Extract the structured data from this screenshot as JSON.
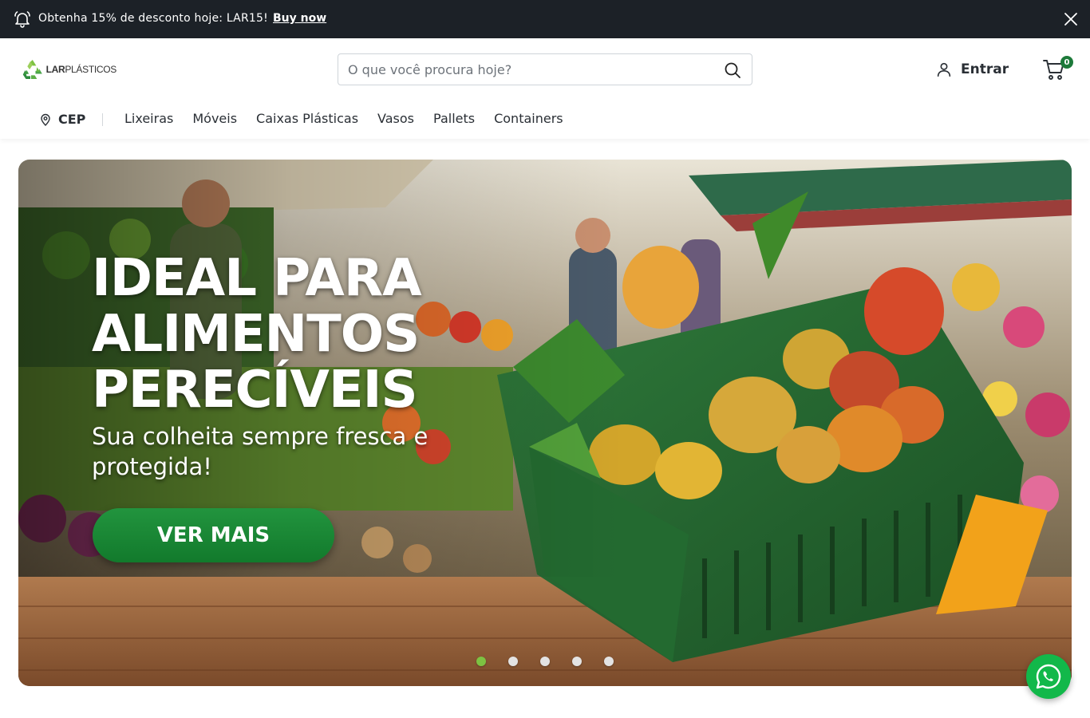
{
  "topbar": {
    "message": "Obtenha 15% de desconto hoje: LAR15!",
    "link_label": "Buy now"
  },
  "header": {
    "logo_text_bold": "LAR",
    "logo_text_thin": "PLÁSTICOS",
    "search_placeholder": "O que você procura hoje?",
    "login_label": "Entrar",
    "cart_count": "0"
  },
  "nav": {
    "cep_label": "CEP",
    "items": [
      "Lixeiras",
      "Móveis",
      "Caixas Plásticas",
      "Vasos",
      "Pallets",
      "Containers"
    ]
  },
  "hero": {
    "headline": [
      "IDEAL PARA",
      "ALIMENTOS",
      "PERECÍVEIS"
    ],
    "subtitle": "Sua colheita sempre fresca e protegida!",
    "cta_label": "VER MAIS",
    "slides_total": 5,
    "active_slide": 1
  },
  "colors": {
    "topbar_bg": "#1c2127",
    "accent_green": "#1d7a3a",
    "cta_green": "#1b8a36",
    "active_dot": "#7dc242",
    "whatsapp_green": "#12b84a"
  },
  "icons": [
    "bell-icon",
    "close-icon",
    "search-icon",
    "user-icon",
    "cart-icon",
    "pin-icon",
    "whatsapp-icon",
    "recycle-logo-icon"
  ]
}
